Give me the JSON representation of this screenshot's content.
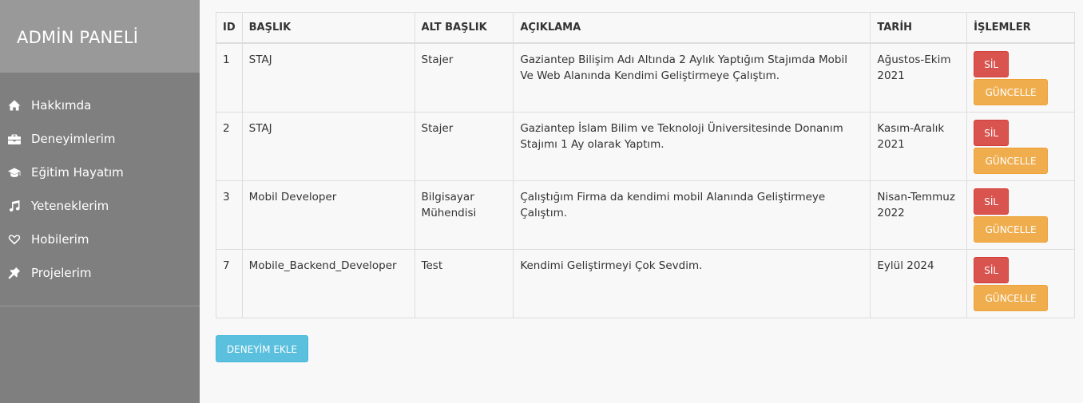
{
  "sidebar": {
    "title": "ADMİN PANELİ",
    "items": [
      {
        "label": "Hakkımda",
        "icon": "home-icon"
      },
      {
        "label": "Deneyimlerim",
        "icon": "briefcase-icon"
      },
      {
        "label": "Eğitim Hayatım",
        "icon": "graduation-cap-icon"
      },
      {
        "label": "Yeteneklerim",
        "icon": "music-icon"
      },
      {
        "label": "Hobilerim",
        "icon": "heart-icon"
      },
      {
        "label": "Projelerim",
        "icon": "pushpin-icon"
      }
    ]
  },
  "table": {
    "headers": {
      "id": "ID",
      "baslik": "BAŞLIK",
      "alt_baslik": "ALT BAŞLIK",
      "aciklama": "AÇIKLAMA",
      "tarih": "TARİH",
      "islemler": "İŞLEMLER"
    },
    "rows": [
      {
        "id": "1",
        "baslik": "STAJ",
        "alt_baslik": "Stajer",
        "aciklama": "Gaziantep Bilişim Adı Altında 2 Aylık Yaptığım Stajımda Mobil Ve Web Alanında Kendimi Geliştirmeye Çalıştım.",
        "tarih": "Ağustos-Ekim 2021"
      },
      {
        "id": "2",
        "baslik": "STAJ",
        "alt_baslik": "Stajer",
        "aciklama": "Gaziantep İslam Bilim ve Teknoloji Üniversitesinde Donanım Stajımı 1 Ay olarak Yaptım.",
        "tarih": "Kasım-Aralık 2021"
      },
      {
        "id": "3",
        "baslik": "Mobil Developer",
        "alt_baslik": "Bilgisayar Mühendisi",
        "aciklama": "Çalıştığım Firma da kendimi mobil Alanında Geliştirmeye Çalıştım.",
        "tarih": "Nisan-Temmuz 2022"
      },
      {
        "id": "7",
        "baslik": "Mobile_Backend_Developer",
        "alt_baslik": "Test",
        "aciklama": "Kendimi Geliştirmeyi Çok Sevdim.",
        "tarih": "Eylül 2024"
      }
    ],
    "delete_label": "SİL",
    "update_label": "GÜNCELLE"
  },
  "add_button_label": "DENEYİM EKLE",
  "colors": {
    "sidebar_bg": "#7f7f7f",
    "sidebar_header_bg": "#999999",
    "danger": "#d9534f",
    "warning": "#f0ad4e",
    "info": "#5bc0de"
  }
}
